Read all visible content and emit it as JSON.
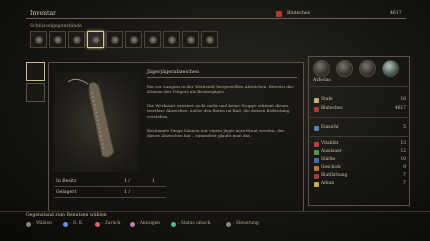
{
  "header": {
    "title": "Inventar",
    "subtitle": "Schlüsselgegenstände",
    "blood_label": "Blutechos",
    "blood_value": "4617"
  },
  "tabs": [
    {
      "icon": "consumables-icon"
    },
    {
      "icon": "materials-icon"
    },
    {
      "icon": "key-items-icon",
      "selected": true
    },
    {
      "icon": "weapon-icon"
    },
    {
      "icon": "firearm-icon"
    },
    {
      "icon": "armor-icon"
    },
    {
      "icon": "rune-icon"
    },
    {
      "icon": "gem-icon"
    },
    {
      "icon": "chalice-icon"
    },
    {
      "icon": "tool-icon"
    }
  ],
  "item": {
    "name": "Jägerjägerabzeichen",
    "description_1": "Ein vor Langem in der Werkstatt hergestelltes Abzeichen. Beweist das Können des Trägers als Bestienjäger.",
    "description_2": "Die Werkstatt existiert nicht mehr und keine Gruppe erkennt dieses wertlose Abzeichen, außer den Boten im Bad, die dessen Bedeutung verstehen.",
    "description_3": "Bestimmte Dinge können nur einem Jäger anvertraut werden, der dieses Abzeichen hat – zumindest glaubt man das.",
    "owned_label": "In Besitz",
    "owned_value": "1 /",
    "owned_max": "1",
    "stored_label": "Gelagert",
    "stored_value": "1 /"
  },
  "character": {
    "name": "Arbolas"
  },
  "stats": [
    {
      "label": "Stufe",
      "value": "16",
      "icon": "level-icon",
      "color": "#c9b26a"
    },
    {
      "label": "Blutechos",
      "value": "4617",
      "icon": "blood-echo-icon",
      "color": "#b23a2e"
    },
    {
      "label": "Einsicht",
      "value": "5",
      "icon": "insight-icon",
      "color": "#5b7fb0"
    },
    {
      "label": "Vitalität",
      "value": "13",
      "icon": "vitality-icon",
      "color": "#b9413a"
    },
    {
      "label": "Ausdauer",
      "value": "12",
      "icon": "endurance-icon",
      "color": "#4f9b48"
    },
    {
      "label": "Stärke",
      "value": "10",
      "icon": "strength-icon",
      "color": "#3d6fa8"
    },
    {
      "label": "Geschick",
      "value": "9",
      "icon": "skill-icon",
      "color": "#c0792c"
    },
    {
      "label": "Blutfärbung",
      "value": "7",
      "icon": "bloodtinge-icon",
      "color": "#a63a3a"
    },
    {
      "label": "Arkan",
      "value": "7",
      "icon": "arcane-icon",
      "color": "#c6b04b"
    }
  ],
  "footer": {
    "hint": "Gegenstand zum Benutzen wählen",
    "controls": [
      {
        "label": ": Wählen",
        "icon": "dpad-icon",
        "color": "#8a8578"
      },
      {
        "label": ": O. K.",
        "icon": "cross-button-icon",
        "color": "#6b8fd6"
      },
      {
        "label": ": Zurück",
        "icon": "circle-button-icon",
        "color": "#d26a6a"
      },
      {
        "label": ": Anzeigen",
        "icon": "square-button-icon",
        "color": "#c77bb8"
      },
      {
        "label": ": Status umsch.",
        "icon": "triangle-button-icon",
        "color": "#56b59a"
      },
      {
        "label": ": Steuerung",
        "icon": "options-button-icon",
        "color": "#8a8578"
      }
    ]
  }
}
